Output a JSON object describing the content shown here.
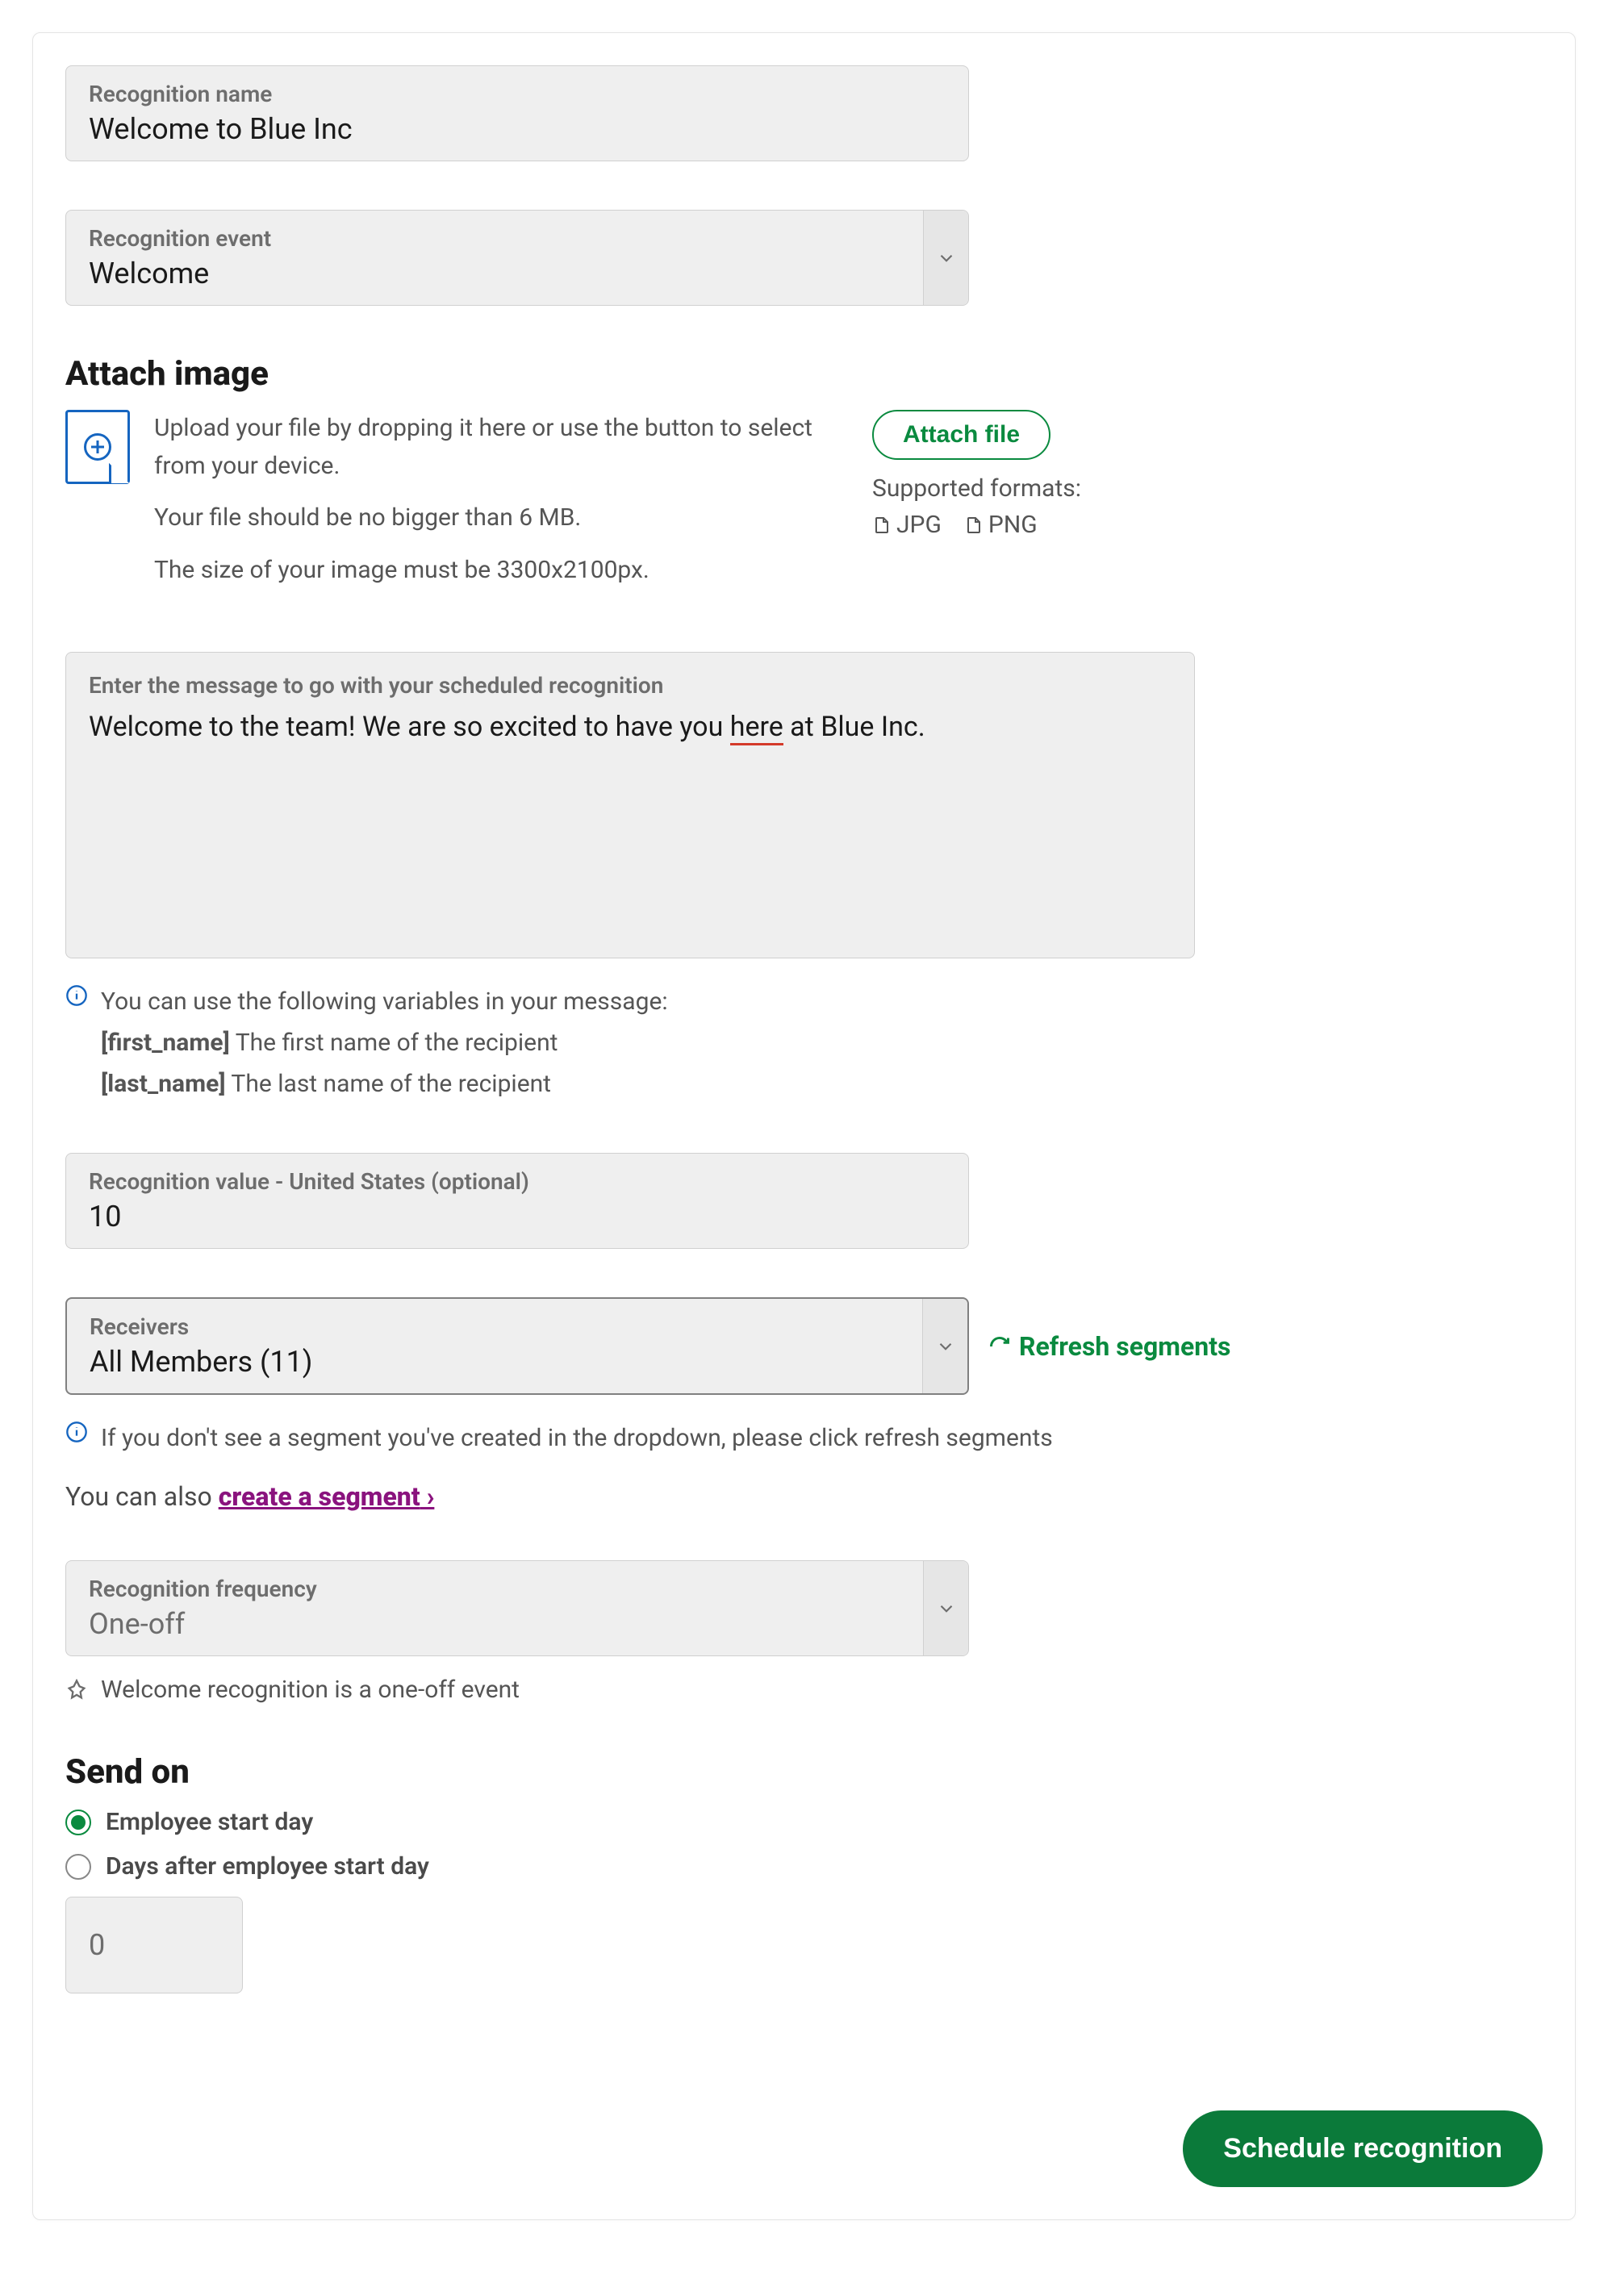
{
  "recognition_name": {
    "label": "Recognition name",
    "value": "Welcome to Blue Inc"
  },
  "recognition_event": {
    "label": "Recognition event",
    "value": "Welcome"
  },
  "attach_image": {
    "heading": "Attach image",
    "hint1": "Upload your file by dropping it here or use the button to select from your device.",
    "hint2": "Your file should be no bigger than 6 MB.",
    "hint3": "The size of your image must be 3300x2100px.",
    "button": "Attach file",
    "supported_label": "Supported formats:",
    "formats": [
      "JPG",
      "PNG"
    ]
  },
  "message": {
    "label": "Enter the message to go with your scheduled recognition",
    "value_pre": "Welcome to the team! We are so excited to have you ",
    "value_flag": "here",
    "value_post": " at Blue Inc."
  },
  "variables_note": {
    "intro": "You can use the following variables in your message:",
    "var1": "[first_name]",
    "var1_desc": " The first name of the recipient",
    "var2": "[last_name]",
    "var2_desc": " The last name of the recipient"
  },
  "recognition_value": {
    "label": "Recognition value - United States (optional)",
    "value": "10"
  },
  "receivers": {
    "label": "Receivers",
    "value": "All Members (11)"
  },
  "refresh_segments": "Refresh segments",
  "receivers_hint": "If you don't see a segment you've created in the dropdown, please click refresh segments",
  "create_segment": {
    "prefix": "You can also ",
    "link": "create a segment"
  },
  "recognition_frequency": {
    "label": "Recognition frequency",
    "value": "One-off"
  },
  "frequency_note": "Welcome recognition is a one-off event",
  "send_on": {
    "heading": "Send on",
    "option1": "Employee start day",
    "option2": "Days after employee start day",
    "selected": "option1",
    "days_value": "0"
  },
  "submit_button": "Schedule recognition"
}
